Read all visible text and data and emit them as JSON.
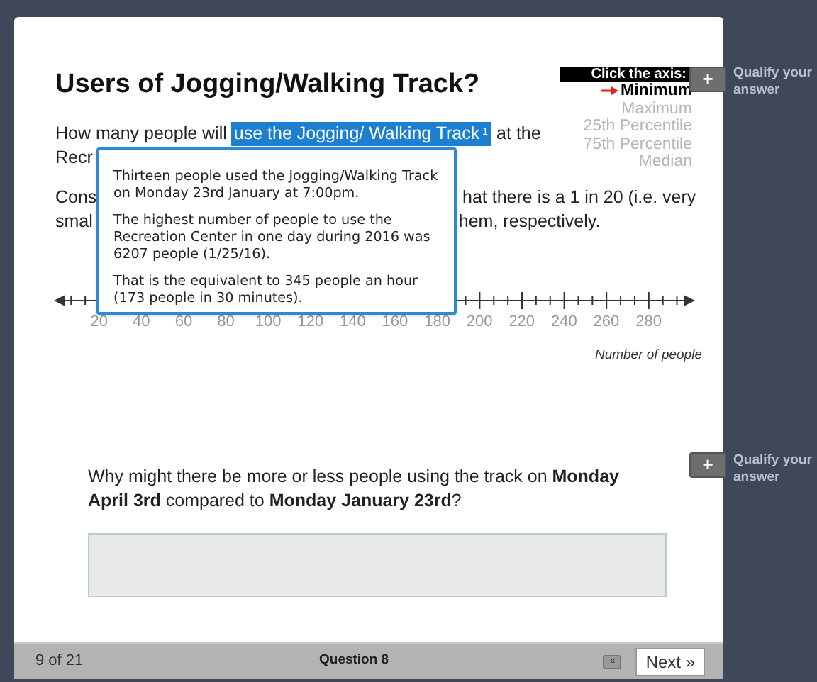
{
  "title": "Users of Jogging/Walking Track?",
  "intro": {
    "before": "How many people will",
    "highlight": "use the Jogging/ Walking Track",
    "footnote": "1",
    "after": "at the"
  },
  "visible_lines": [
    {
      "start": "Recr"
    },
    {
      "start": "Cons",
      "end": "hat there is a 1 in 20 (i.e. very"
    },
    {
      "start": "smal",
      "end": "hem, respectively."
    }
  ],
  "tooltip": [
    "Thirteen people used the Jogging/Walking Track on Monday 23rd January at 7:00pm.",
    "The highest number of people to use the Recreation Center in one day during 2016 was 6207 people (1/25/16).",
    "That is the equivalent to 345 people an hour (173 people in 30 minutes)."
  ],
  "legend": {
    "header": "Click the axis:",
    "options": [
      {
        "label": "Minimum",
        "selected": true
      },
      {
        "label": "Maximum",
        "selected": false
      },
      {
        "label": "25th Percentile",
        "selected": false
      },
      {
        "label": "75th Percentile",
        "selected": false
      },
      {
        "label": "Median",
        "selected": false
      }
    ]
  },
  "qualify": [
    {
      "button": "+",
      "label": "Qualify your answer"
    },
    {
      "button": "+",
      "label": "Qualify your answer"
    }
  ],
  "axis": {
    "labels": [
      "20",
      "40",
      "60",
      "80",
      "100",
      "120",
      "140",
      "160",
      "180",
      "200",
      "220",
      "240",
      "260",
      "280"
    ],
    "title": "Number of people"
  },
  "question2": "Why might there be more or less people using the track on **Monday April 3rd** compared to **Monday January 23rd**?",
  "footer": {
    "page": "9 of 21",
    "question": "Question 8",
    "prev": "«",
    "next": "Next »"
  }
}
